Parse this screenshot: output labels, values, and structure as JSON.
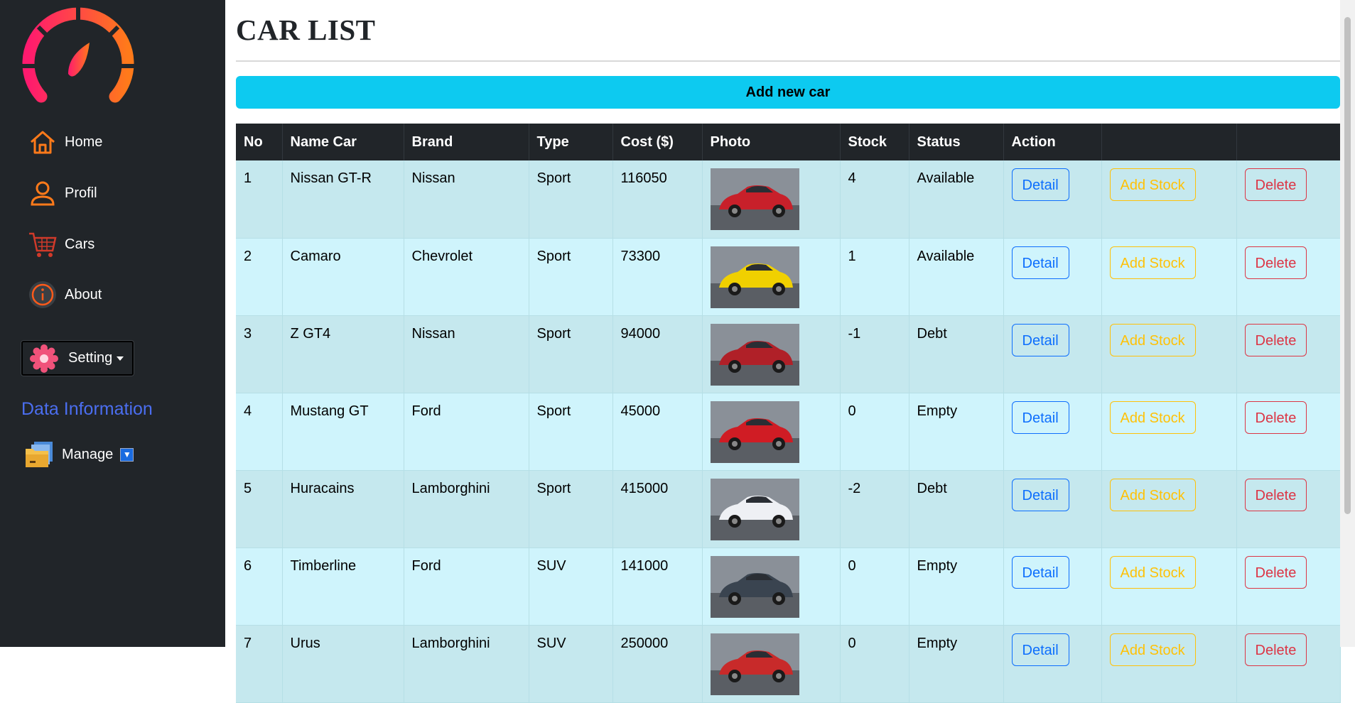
{
  "sidebar": {
    "nav": [
      {
        "label": "Home",
        "icon": "home-icon"
      },
      {
        "label": "Profil",
        "icon": "user-icon"
      },
      {
        "label": "Cars",
        "icon": "cart-icon"
      },
      {
        "label": "About",
        "icon": "info-icon"
      }
    ],
    "setting_label": "Setting",
    "data_info_heading": "Data Information",
    "manage_label": "Manage",
    "manage_toggle": "▼"
  },
  "page": {
    "title": "CAR LIST",
    "add_button": "Add new car"
  },
  "table": {
    "headers": [
      "No",
      "Name Car",
      "Brand",
      "Type",
      "Cost ($)",
      "Photo",
      "Stock",
      "Status",
      "Action",
      "",
      ""
    ],
    "rows": [
      {
        "no": "1",
        "name": "Nissan GT-R",
        "brand": "Nissan",
        "type": "Sport",
        "cost": "116050",
        "stock": "4",
        "status": "Available",
        "photo_color": "#c8202a"
      },
      {
        "no": "2",
        "name": "Camaro",
        "brand": "Chevrolet",
        "type": "Sport",
        "cost": "73300",
        "stock": "1",
        "status": "Available",
        "photo_color": "#f0d000"
      },
      {
        "no": "3",
        "name": "Z GT4",
        "brand": "Nissan",
        "type": "Sport",
        "cost": "94000",
        "stock": "-1",
        "status": "Debt",
        "photo_color": "#b02028"
      },
      {
        "no": "4",
        "name": "Mustang GT",
        "brand": "Ford",
        "type": "Sport",
        "cost": "45000",
        "stock": "0",
        "status": "Empty",
        "photo_color": "#d01c24"
      },
      {
        "no": "5",
        "name": "Huracains",
        "brand": "Lamborghini",
        "type": "Sport",
        "cost": "415000",
        "stock": "-2",
        "status": "Debt",
        "photo_color": "#eef0f4"
      },
      {
        "no": "6",
        "name": "Timberline",
        "brand": "Ford",
        "type": "SUV",
        "cost": "141000",
        "stock": "0",
        "status": "Empty",
        "photo_color": "#3a4450"
      },
      {
        "no": "7",
        "name": "Urus",
        "brand": "Lamborghini",
        "type": "SUV",
        "cost": "250000",
        "stock": "0",
        "status": "Empty",
        "photo_color": "#c82a2a"
      }
    ],
    "actions": {
      "detail": "Detail",
      "add_stock": "Add Stock",
      "delete": "Delete"
    }
  },
  "colors": {
    "sidebar_bg": "#212529",
    "accent_cyan": "#0dcaf0",
    "row_odd": "#c5e8ee",
    "row_even": "#cff4fc",
    "primary": "#0d6efd",
    "warning": "#ffc107",
    "danger": "#dc3545",
    "logo_gradient_start": "#ff1a6e",
    "logo_gradient_end": "#ff7a1a",
    "data_info_blue": "#4b6ef0"
  }
}
